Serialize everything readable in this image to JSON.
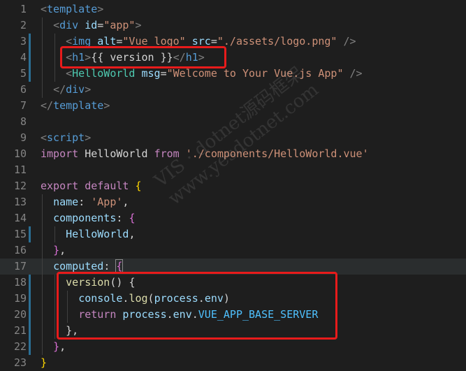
{
  "colors": {
    "background": "#1e1e1e",
    "line_number": "#858585",
    "highlight_box": "#e81b1b",
    "change_bar": "#2b6f94"
  },
  "watermark": {
    "line1": "VIS · dotnet源码框架",
    "line2": "www.yesdotnet.com"
  },
  "lines": [
    {
      "n": "1",
      "guides": [],
      "tokens": [
        {
          "t": "<",
          "c": "punct"
        },
        {
          "t": "template",
          "c": "tag"
        },
        {
          "t": ">",
          "c": "punct"
        }
      ]
    },
    {
      "n": "2",
      "guides": [
        0
      ],
      "tokens": [
        {
          "t": "  "
        },
        {
          "t": "<",
          "c": "punct"
        },
        {
          "t": "div",
          "c": "tag"
        },
        {
          "t": " "
        },
        {
          "t": "id",
          "c": "attr"
        },
        {
          "t": "=",
          "c": "plain"
        },
        {
          "t": "\"app\"",
          "c": "str"
        },
        {
          "t": ">",
          "c": "punct"
        }
      ]
    },
    {
      "n": "3",
      "guides": [
        0,
        1
      ],
      "change": true,
      "tokens": [
        {
          "t": "    "
        },
        {
          "t": "<",
          "c": "punct"
        },
        {
          "t": "img",
          "c": "tag"
        },
        {
          "t": " "
        },
        {
          "t": "alt",
          "c": "attr"
        },
        {
          "t": "=",
          "c": "plain"
        },
        {
          "t": "\"Vue logo\"",
          "c": "str"
        },
        {
          "t": " "
        },
        {
          "t": "src",
          "c": "attr"
        },
        {
          "t": "=",
          "c": "plain"
        },
        {
          "t": "\"./assets/logo.png\"",
          "c": "str"
        },
        {
          "t": " "
        },
        {
          "t": "/>",
          "c": "punct"
        }
      ]
    },
    {
      "n": "4",
      "guides": [
        0,
        1
      ],
      "change": true,
      "tokens": [
        {
          "t": "    "
        },
        {
          "t": "<",
          "c": "punct"
        },
        {
          "t": "h1",
          "c": "tag"
        },
        {
          "t": ">",
          "c": "punct"
        },
        {
          "t": "{{ version }}",
          "c": "plain"
        },
        {
          "t": "</",
          "c": "punct"
        },
        {
          "t": "h1",
          "c": "tag"
        },
        {
          "t": ">",
          "c": "punct"
        }
      ]
    },
    {
      "n": "5",
      "guides": [
        0,
        1
      ],
      "change": true,
      "tokens": [
        {
          "t": "    "
        },
        {
          "t": "<",
          "c": "punct"
        },
        {
          "t": "HelloWorld",
          "c": "cls"
        },
        {
          "t": " "
        },
        {
          "t": "msg",
          "c": "attr"
        },
        {
          "t": "=",
          "c": "plain"
        },
        {
          "t": "\"Welcome to Your Vue.js App\"",
          "c": "str"
        },
        {
          "t": " "
        },
        {
          "t": "/>",
          "c": "punct"
        }
      ]
    },
    {
      "n": "6",
      "guides": [
        0
      ],
      "tokens": [
        {
          "t": "  "
        },
        {
          "t": "</",
          "c": "punct"
        },
        {
          "t": "div",
          "c": "tag"
        },
        {
          "t": ">",
          "c": "punct"
        }
      ]
    },
    {
      "n": "7",
      "guides": [],
      "tokens": [
        {
          "t": "</",
          "c": "punct"
        },
        {
          "t": "template",
          "c": "tag"
        },
        {
          "t": ">",
          "c": "punct"
        }
      ]
    },
    {
      "n": "8",
      "guides": [],
      "tokens": []
    },
    {
      "n": "9",
      "guides": [],
      "tokens": [
        {
          "t": "<",
          "c": "punct"
        },
        {
          "t": "script",
          "c": "tag"
        },
        {
          "t": ">",
          "c": "punct"
        }
      ]
    },
    {
      "n": "10",
      "guides": [],
      "tokens": [
        {
          "t": "import",
          "c": "kw"
        },
        {
          "t": " "
        },
        {
          "t": "HelloWorld",
          "c": "plain"
        },
        {
          "t": " "
        },
        {
          "t": "from",
          "c": "kw"
        },
        {
          "t": " "
        },
        {
          "t": "'./components/HelloWorld.vue'",
          "c": "str"
        }
      ]
    },
    {
      "n": "11",
      "guides": [],
      "tokens": []
    },
    {
      "n": "12",
      "guides": [],
      "tokens": [
        {
          "t": "export",
          "c": "kw"
        },
        {
          "t": " "
        },
        {
          "t": "default",
          "c": "kw"
        },
        {
          "t": " "
        },
        {
          "t": "{",
          "c": "brace"
        }
      ]
    },
    {
      "n": "13",
      "guides": [
        0
      ],
      "tokens": [
        {
          "t": "  "
        },
        {
          "t": "name",
          "c": "prop"
        },
        {
          "t": ": ",
          "c": "plain"
        },
        {
          "t": "'App'",
          "c": "str"
        },
        {
          "t": ",",
          "c": "plain"
        }
      ]
    },
    {
      "n": "14",
      "guides": [
        0
      ],
      "tokens": [
        {
          "t": "  "
        },
        {
          "t": "components",
          "c": "prop"
        },
        {
          "t": ": ",
          "c": "plain"
        },
        {
          "t": "{",
          "c": "brace2"
        }
      ]
    },
    {
      "n": "15",
      "guides": [
        0,
        1
      ],
      "change": true,
      "tokens": [
        {
          "t": "    "
        },
        {
          "t": "HelloWorld",
          "c": "prop"
        },
        {
          "t": ",",
          "c": "plain"
        }
      ]
    },
    {
      "n": "16",
      "guides": [
        0
      ],
      "tokens": [
        {
          "t": "  "
        },
        {
          "t": "}",
          "c": "brace2"
        },
        {
          "t": ",",
          "c": "plain"
        }
      ]
    },
    {
      "n": "17",
      "guides": [
        0
      ],
      "active": true,
      "tokens": [
        {
          "t": "  "
        },
        {
          "t": "computed",
          "c": "prop"
        },
        {
          "t": ": ",
          "c": "plain"
        },
        {
          "t": "{",
          "c": "brace2",
          "box": true
        }
      ]
    },
    {
      "n": "18",
      "guides": [
        0,
        1
      ],
      "change": true,
      "tokens": [
        {
          "t": "    "
        },
        {
          "t": "version",
          "c": "fn"
        },
        {
          "t": "() ",
          "c": "plain"
        },
        {
          "t": "{",
          "c": "plain"
        }
      ]
    },
    {
      "n": "19",
      "guides": [
        0,
        1,
        2
      ],
      "change": true,
      "tokens": [
        {
          "t": "      "
        },
        {
          "t": "console",
          "c": "prop"
        },
        {
          "t": ".",
          "c": "plain"
        },
        {
          "t": "log",
          "c": "fn"
        },
        {
          "t": "(",
          "c": "plain"
        },
        {
          "t": "process",
          "c": "prop"
        },
        {
          "t": ".",
          "c": "plain"
        },
        {
          "t": "env",
          "c": "prop"
        },
        {
          "t": ")",
          "c": "plain"
        }
      ]
    },
    {
      "n": "20",
      "guides": [
        0,
        1,
        2
      ],
      "change": true,
      "tokens": [
        {
          "t": "      "
        },
        {
          "t": "return",
          "c": "kw"
        },
        {
          "t": " "
        },
        {
          "t": "process",
          "c": "prop"
        },
        {
          "t": ".",
          "c": "plain"
        },
        {
          "t": "env",
          "c": "prop"
        },
        {
          "t": ".",
          "c": "plain"
        },
        {
          "t": "VUE_APP_BASE_SERVER",
          "c": "const"
        }
      ]
    },
    {
      "n": "21",
      "guides": [
        0,
        1
      ],
      "change": true,
      "tokens": [
        {
          "t": "    "
        },
        {
          "t": "}",
          "c": "plain"
        },
        {
          "t": ",",
          "c": "plain"
        }
      ]
    },
    {
      "n": "22",
      "guides": [
        0
      ],
      "change": true,
      "tokens": [
        {
          "t": "  "
        },
        {
          "t": "}",
          "c": "brace2"
        },
        {
          "t": ",",
          "c": "plain"
        }
      ]
    },
    {
      "n": "23",
      "guides": [],
      "tokens": [
        {
          "t": "}",
          "c": "brace"
        }
      ]
    }
  ]
}
